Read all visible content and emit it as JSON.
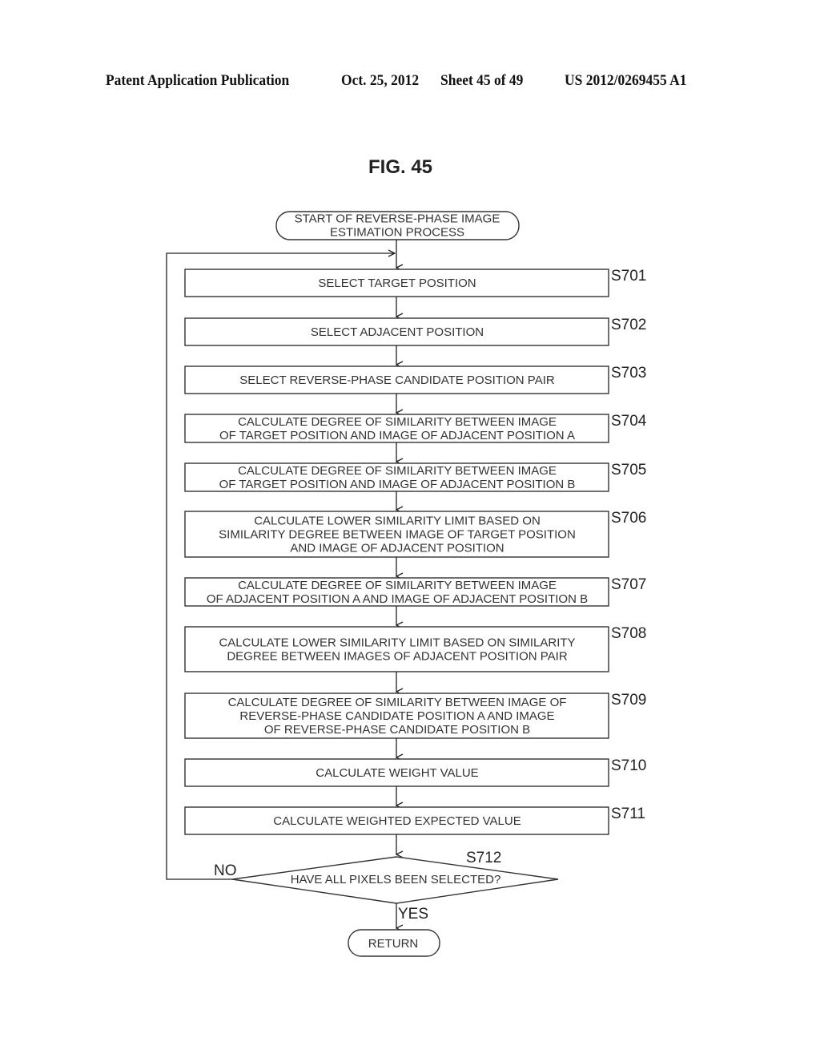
{
  "header": {
    "publication": "Patent Application Publication",
    "date": "Oct. 25, 2012",
    "sheet": "Sheet 45 of 49",
    "number": "US 2012/0269455 A1"
  },
  "figure_title": "FIG. 45",
  "flowchart": {
    "start": [
      "START OF REVERSE-PHASE IMAGE",
      "ESTIMATION PROCESS"
    ],
    "steps": [
      {
        "id": "S701",
        "lines": [
          "SELECT TARGET POSITION"
        ]
      },
      {
        "id": "S702",
        "lines": [
          "SELECT ADJACENT POSITION"
        ]
      },
      {
        "id": "S703",
        "lines": [
          "SELECT REVERSE-PHASE CANDIDATE POSITION PAIR"
        ]
      },
      {
        "id": "S704",
        "lines": [
          "CALCULATE DEGREE OF SIMILARITY BETWEEN IMAGE",
          "OF TARGET POSITION AND IMAGE OF ADJACENT POSITION A"
        ]
      },
      {
        "id": "S705",
        "lines": [
          "CALCULATE DEGREE OF SIMILARITY BETWEEN IMAGE",
          "OF TARGET POSITION AND IMAGE OF ADJACENT POSITION B"
        ]
      },
      {
        "id": "S706",
        "lines": [
          "CALCULATE LOWER SIMILARITY LIMIT BASED ON",
          "SIMILARITY DEGREE BETWEEN IMAGE OF TARGET POSITION",
          "AND IMAGE OF ADJACENT POSITION"
        ]
      },
      {
        "id": "S707",
        "lines": [
          "CALCULATE DEGREE OF SIMILARITY BETWEEN IMAGE",
          "OF ADJACENT POSITION A AND IMAGE OF ADJACENT POSITION B"
        ]
      },
      {
        "id": "S708",
        "lines": [
          "CALCULATE LOWER SIMILARITY LIMIT BASED ON SIMILARITY",
          "DEGREE BETWEEN IMAGES OF ADJACENT POSITION PAIR"
        ]
      },
      {
        "id": "S709",
        "lines": [
          "CALCULATE DEGREE OF SIMILARITY BETWEEN IMAGE OF",
          "REVERSE-PHASE CANDIDATE POSITION A AND IMAGE",
          "OF REVERSE-PHASE CANDIDATE POSITION B"
        ]
      },
      {
        "id": "S710",
        "lines": [
          "CALCULATE WEIGHT VALUE"
        ]
      },
      {
        "id": "S711",
        "lines": [
          "CALCULATE WEIGHTED EXPECTED VALUE"
        ]
      }
    ],
    "decision": {
      "id": "S712",
      "text": "HAVE ALL PIXELS BEEN SELECTED?",
      "no_label": "NO",
      "yes_label": "YES"
    },
    "end": "RETURN"
  }
}
